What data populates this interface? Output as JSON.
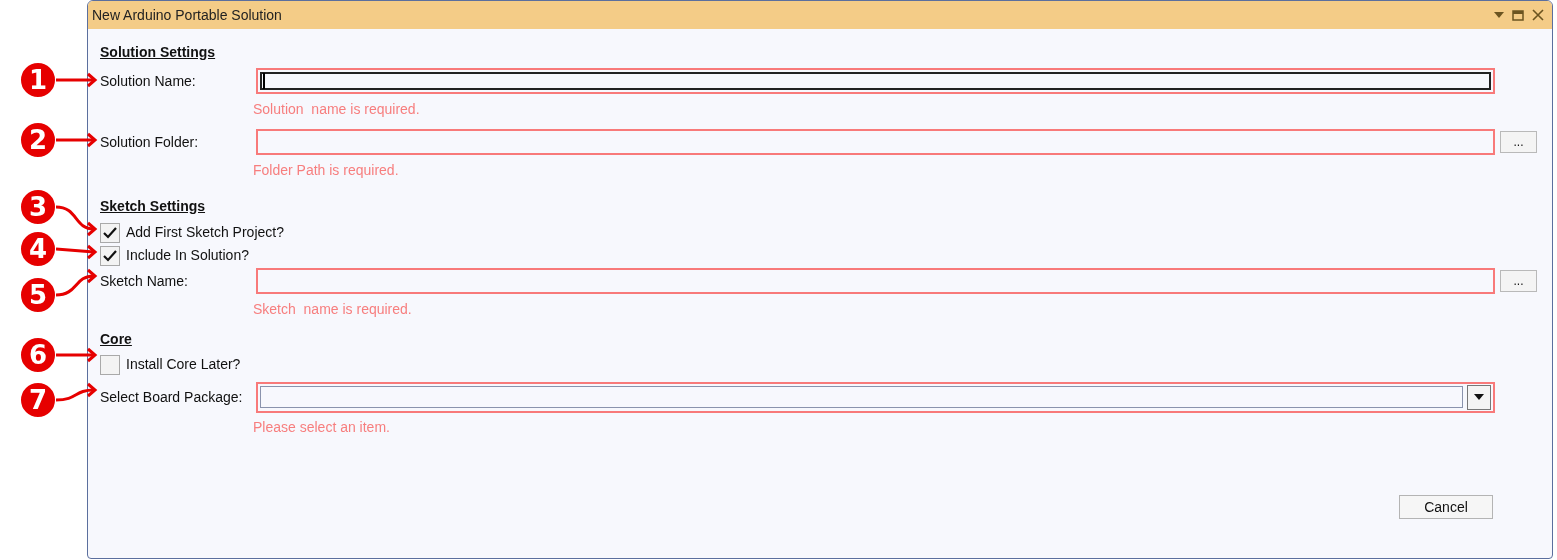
{
  "window": {
    "title": "New Arduino Portable Solution"
  },
  "sections": [
    {
      "heading": "Solution Settings",
      "items": [
        {
          "kind": "field",
          "label": "Solution Name:",
          "focused": true,
          "error": "Solution  name is required."
        },
        {
          "kind": "field",
          "label": "Solution Folder:",
          "focused": false,
          "error": "Folder Path is required.",
          "browse_label": "..."
        }
      ]
    },
    {
      "heading": "Sketch Settings",
      "items": [
        {
          "kind": "checkbox",
          "label": "Add First Sketch Project?",
          "checked": true
        },
        {
          "kind": "checkbox",
          "label": "Include In Solution?",
          "checked": true
        },
        {
          "kind": "field",
          "label": "Sketch Name:",
          "focused": false,
          "error": "Sketch  name is required.",
          "browse_label": "..."
        }
      ]
    },
    {
      "heading": "Core",
      "items": [
        {
          "kind": "checkbox",
          "label": "Install Core Later?",
          "checked": false
        },
        {
          "kind": "select",
          "label": "Select Board Package:",
          "error": "Please select an item."
        }
      ]
    }
  ],
  "cancel": "Cancel",
  "callouts": [
    {
      "number": "1",
      "kind": "straight"
    },
    {
      "number": "2",
      "kind": "straight"
    },
    {
      "number": "3",
      "kind": "curved"
    },
    {
      "number": "4",
      "kind": "straight"
    },
    {
      "number": "5",
      "kind": "curved"
    },
    {
      "number": "6",
      "kind": "straight"
    },
    {
      "number": "7",
      "kind": "curved"
    }
  ]
}
